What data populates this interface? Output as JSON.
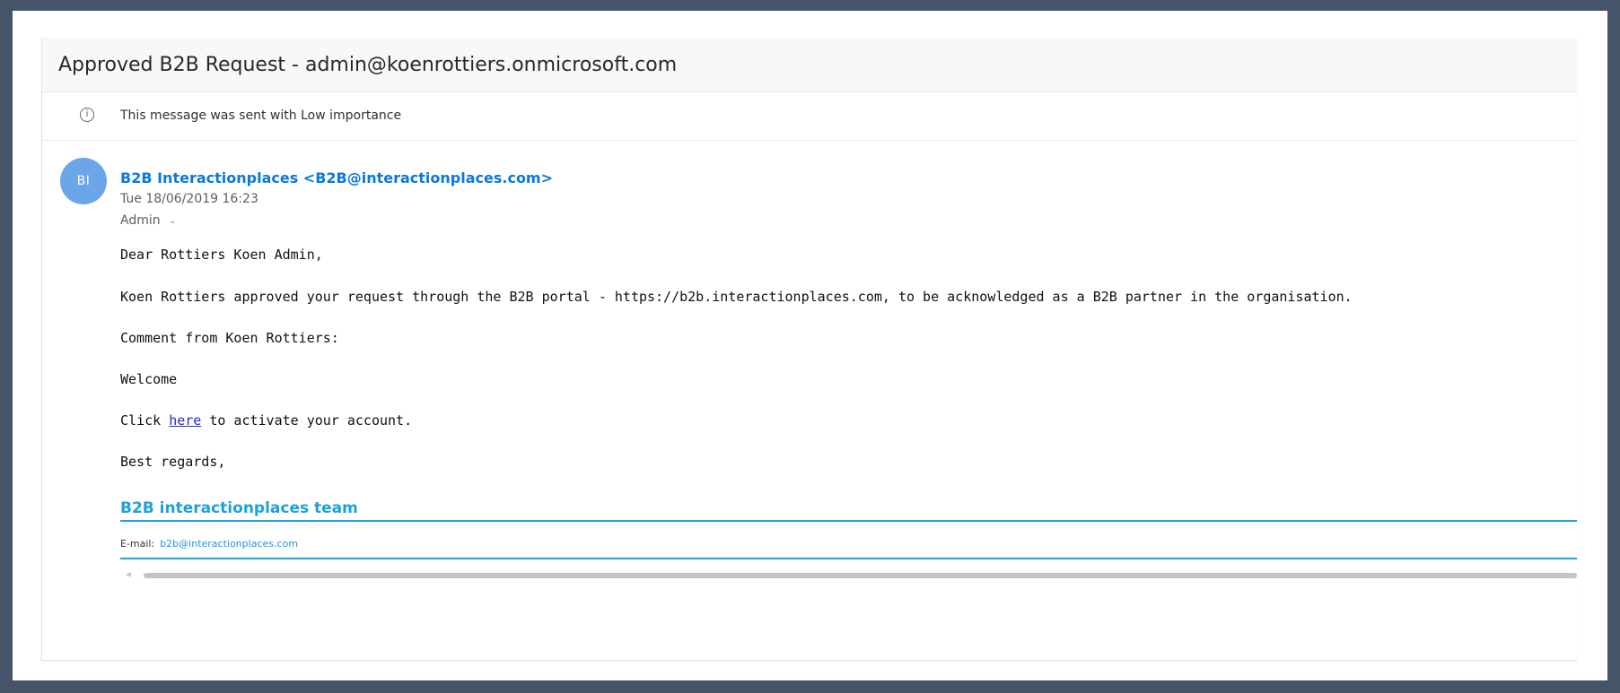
{
  "email": {
    "subject": "Approved B2B Request - admin@koenrottiers.onmicrosoft.com",
    "importance_notice": "This message was sent with Low importance",
    "info_icon": "info-icon",
    "avatar_initials": "BI",
    "sender": "B2B Interactionplaces <B2B@interactionplaces.com>",
    "date": "Tue 18/06/2019 16:23",
    "recipient": "Admin",
    "recipient_icon": "chevron-down-icon",
    "body": {
      "greeting": "Dear Rottiers Koen Admin,",
      "approval_message": "Koen Rottiers approved your request through the B2B portal - https://b2b.interactionplaces.com, to be acknowledged as a B2B partner in the organisation.",
      "comment_label": "Comment from Koen Rottiers:",
      "comment": "Welcome",
      "activation_prefix": "Click ",
      "activation_link": "here",
      "activation_suffix": " to activate your account.",
      "closing": "Best regards,"
    },
    "signature": {
      "name": "B2B interactionplaces team",
      "email_label": "E-mail:",
      "email": "b2b@interactionplaces.com"
    },
    "colors": {
      "outer_frame": "#46546a",
      "avatar": "#6aa6e8",
      "sender": "#0b79d8",
      "signature_accent": "#1da2d6",
      "body_link": "#2626d8"
    }
  }
}
